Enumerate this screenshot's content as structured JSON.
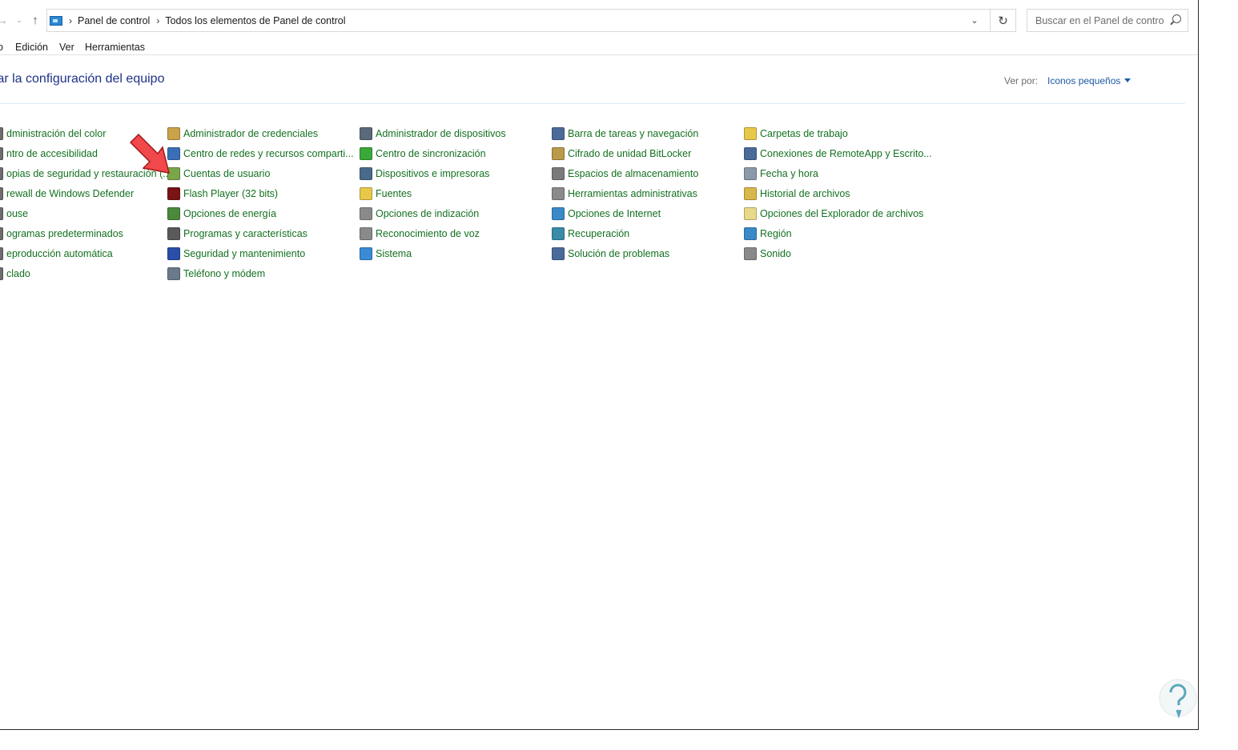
{
  "address_bar": {
    "breadcrumbs": [
      "Panel de control",
      "Todos los elementos de Panel de control"
    ],
    "search_placeholder": "Buscar en el Panel de control"
  },
  "menu": [
    "o",
    "Edición",
    "Ver",
    "Herramientas"
  ],
  "header": {
    "title": "tar la configuración del equipo",
    "view_by_label": "Ver por:",
    "view_by_value": "Iconos pequeños"
  },
  "columns": [
    {
      "items": [
        {
          "label": "dministración del color",
          "icon": "color-management-icon",
          "color": "#6d6d6d"
        },
        {
          "label": "ntro de accesibilidad",
          "icon": "ease-of-access-icon",
          "color": "#6d6d6d"
        },
        {
          "label": "opias de seguridad y restauración (...",
          "icon": "backup-icon",
          "color": "#6d6d6d"
        },
        {
          "label": "rewall de Windows Defender",
          "icon": "firewall-icon",
          "color": "#6d6d6d"
        },
        {
          "label": "ouse",
          "icon": "mouse-icon",
          "color": "#6d6d6d"
        },
        {
          "label": "ogramas predeterminados",
          "icon": "default-programs-icon",
          "color": "#6d6d6d"
        },
        {
          "label": "eproducción automática",
          "icon": "autoplay-icon",
          "color": "#6d6d6d"
        },
        {
          "label": "clado",
          "icon": "keyboard-icon",
          "color": "#6d6d6d"
        }
      ]
    },
    {
      "items": [
        {
          "label": "Administrador de credenciales",
          "icon": "credential-manager-icon",
          "color": "#c9a24a"
        },
        {
          "label": "Centro de redes y recursos comparti...",
          "icon": "network-center-icon",
          "color": "#3a6fb8"
        },
        {
          "label": "Cuentas de usuario",
          "icon": "user-accounts-icon",
          "color": "#7aa54a"
        },
        {
          "label": "Flash Player (32 bits)",
          "icon": "flash-player-icon",
          "color": "#7a1414"
        },
        {
          "label": "Opciones de energía",
          "icon": "power-options-icon",
          "color": "#4a8a3a"
        },
        {
          "label": "Programas y características",
          "icon": "programs-features-icon",
          "color": "#5a5a5a"
        },
        {
          "label": "Seguridad y mantenimiento",
          "icon": "security-flag-icon",
          "color": "#2a4fa8"
        },
        {
          "label": "Teléfono y módem",
          "icon": "phone-modem-icon",
          "color": "#6a7a8a"
        }
      ]
    },
    {
      "items": [
        {
          "label": "Administrador de dispositivos",
          "icon": "device-manager-icon",
          "color": "#5a6a7a"
        },
        {
          "label": "Centro de sincronización",
          "icon": "sync-center-icon",
          "color": "#3aa83a"
        },
        {
          "label": "Dispositivos e impresoras",
          "icon": "devices-printers-icon",
          "color": "#4a6a8a"
        },
        {
          "label": "Fuentes",
          "icon": "fonts-icon",
          "color": "#e8c84a"
        },
        {
          "label": "Opciones de indización",
          "icon": "indexing-options-icon",
          "color": "#8a8a8a"
        },
        {
          "label": "Reconocimiento de voz",
          "icon": "speech-recognition-icon",
          "color": "#8a8a8a"
        },
        {
          "label": "Sistema",
          "icon": "system-icon",
          "color": "#3a8ad6"
        }
      ]
    },
    {
      "items": [
        {
          "label": "Barra de tareas y navegación",
          "icon": "taskbar-icon",
          "color": "#4a6a9a"
        },
        {
          "label": "Cifrado de unidad BitLocker",
          "icon": "bitlocker-icon",
          "color": "#b89a4a"
        },
        {
          "label": "Espacios de almacenamiento",
          "icon": "storage-spaces-icon",
          "color": "#7a7a7a"
        },
        {
          "label": "Herramientas administrativas",
          "icon": "admin-tools-icon",
          "color": "#8a8a8a"
        },
        {
          "label": "Opciones de Internet",
          "icon": "internet-options-icon",
          "color": "#3a8ac8"
        },
        {
          "label": "Recuperación",
          "icon": "recovery-icon",
          "color": "#3a8aa8"
        },
        {
          "label": "Solución de problemas",
          "icon": "troubleshooting-icon",
          "color": "#4a6a9a"
        }
      ]
    },
    {
      "items": [
        {
          "label": "Carpetas de trabajo",
          "icon": "work-folders-icon",
          "color": "#e8c84a"
        },
        {
          "label": "Conexiones de RemoteApp y Escrito...",
          "icon": "remoteapp-icon",
          "color": "#4a6a9a"
        },
        {
          "label": "Fecha y hora",
          "icon": "date-time-icon",
          "color": "#8a9aaa"
        },
        {
          "label": "Historial de archivos",
          "icon": "file-history-icon",
          "color": "#d8b84a"
        },
        {
          "label": "Opciones del Explorador de archivos",
          "icon": "explorer-options-icon",
          "color": "#e8d88a"
        },
        {
          "label": "Región",
          "icon": "region-icon",
          "color": "#3a8ac8"
        },
        {
          "label": "Sonido",
          "icon": "sound-icon",
          "color": "#8a8a8a"
        }
      ]
    }
  ]
}
